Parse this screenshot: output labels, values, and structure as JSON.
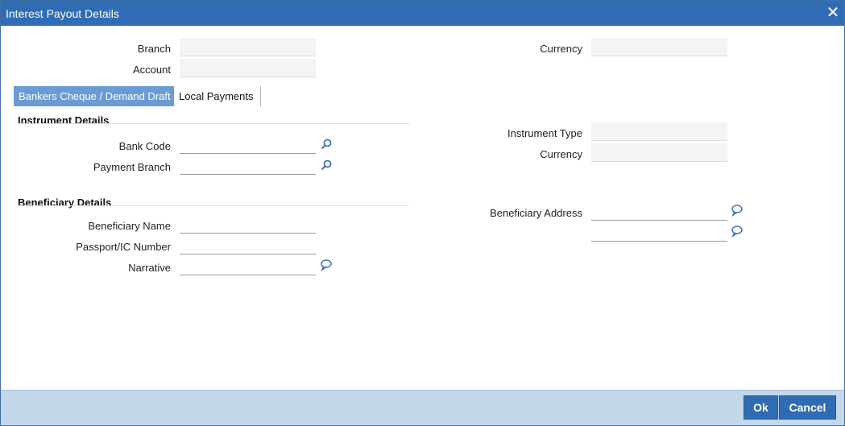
{
  "window": {
    "title": "Interest Payout Details",
    "close_glyph": "✕"
  },
  "header": {
    "branch_label": "Branch",
    "account_label": "Account",
    "currency_label": "Currency",
    "branch_value": "",
    "account_value": "",
    "currency_value": ""
  },
  "tabs": [
    {
      "label": "Bankers Cheque / Demand Draft",
      "active": true
    },
    {
      "label": "Local Payments",
      "active": false
    }
  ],
  "instrument": {
    "section_title": "Instrument Details",
    "bank_code_label": "Bank Code",
    "payment_branch_label": "Payment Branch",
    "instrument_type_label": "Instrument Type",
    "currency_label": "Currency",
    "bank_code_value": "",
    "payment_branch_value": "",
    "instrument_type_value": "",
    "currency_value": ""
  },
  "beneficiary": {
    "section_title": "Beneficiary Details",
    "name_label": "Beneficiary Name",
    "passport_label": "Passport/IC Number",
    "narrative_label": "Narrative",
    "address_label": "Beneficiary Address",
    "name_value": "",
    "passport_value": "",
    "narrative_value": "",
    "address_line1_value": "",
    "address_line2_value": ""
  },
  "icons": {
    "lookup": "search-icon",
    "comment": "speech-bubble-icon"
  },
  "footer": {
    "ok_label": "Ok",
    "cancel_label": "Cancel"
  },
  "colors": {
    "title_bar": "#2f6cb4",
    "active_tab": "#6a9bd4",
    "footer": "#c4d8ec",
    "button": "#2f6cb4"
  }
}
